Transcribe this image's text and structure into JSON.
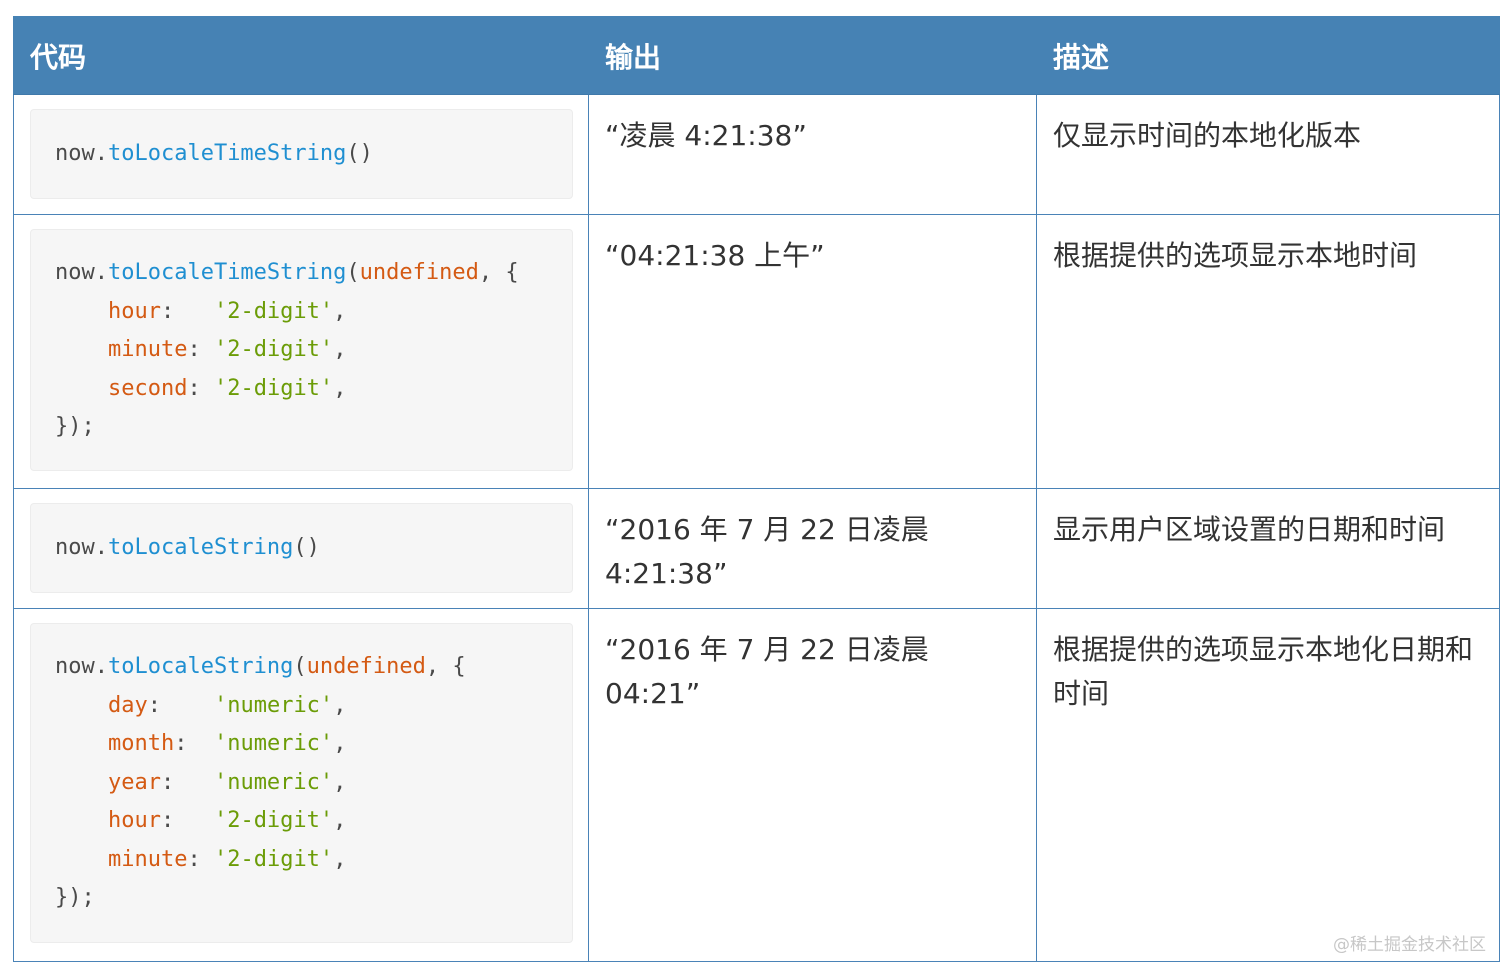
{
  "table": {
    "headers": [
      "代码",
      "输出",
      "描述"
    ],
    "rows": [
      {
        "code": [
          [
            [
              "pun",
              "now."
            ],
            [
              "fn",
              "toLocaleTimeString"
            ],
            [
              "pun",
              "()"
            ]
          ]
        ],
        "output": "“凌晨 4:21:38”",
        "description": "仅显示时间的本地化版本"
      },
      {
        "code": [
          [
            [
              "pun",
              "now."
            ],
            [
              "fn",
              "toLocaleTimeString"
            ],
            [
              "pun",
              "("
            ],
            [
              "kw",
              "undefined"
            ],
            [
              "pun",
              ", {"
            ]
          ],
          [
            [
              "pun",
              "    "
            ],
            [
              "key",
              "hour"
            ],
            [
              "pun",
              ":   "
            ],
            [
              "str",
              "'2-digit'"
            ],
            [
              "pun",
              ","
            ]
          ],
          [
            [
              "pun",
              "    "
            ],
            [
              "key",
              "minute"
            ],
            [
              "pun",
              ": "
            ],
            [
              "str",
              "'2-digit'"
            ],
            [
              "pun",
              ","
            ]
          ],
          [
            [
              "pun",
              "    "
            ],
            [
              "key",
              "second"
            ],
            [
              "pun",
              ": "
            ],
            [
              "str",
              "'2-digit'"
            ],
            [
              "pun",
              ","
            ]
          ],
          [
            [
              "pun",
              "});"
            ]
          ]
        ],
        "output": "“04:21:38 上午”",
        "description": "根据提供的选项显示本地时间"
      },
      {
        "code": [
          [
            [
              "pun",
              "now."
            ],
            [
              "fn",
              "toLocaleString"
            ],
            [
              "pun",
              "()"
            ]
          ]
        ],
        "output": "“2016 年 7 月 22 日凌晨 4:21:38”",
        "description": "显示用户区域设置的日期和时间"
      },
      {
        "code": [
          [
            [
              "pun",
              "now."
            ],
            [
              "fn",
              "toLocaleString"
            ],
            [
              "pun",
              "("
            ],
            [
              "kw",
              "undefined"
            ],
            [
              "pun",
              ", {"
            ]
          ],
          [
            [
              "pun",
              "    "
            ],
            [
              "key",
              "day"
            ],
            [
              "pun",
              ":    "
            ],
            [
              "str",
              "'numeric'"
            ],
            [
              "pun",
              ","
            ]
          ],
          [
            [
              "pun",
              "    "
            ],
            [
              "key",
              "month"
            ],
            [
              "pun",
              ":  "
            ],
            [
              "str",
              "'numeric'"
            ],
            [
              "pun",
              ","
            ]
          ],
          [
            [
              "pun",
              "    "
            ],
            [
              "key",
              "year"
            ],
            [
              "pun",
              ":   "
            ],
            [
              "str",
              "'numeric'"
            ],
            [
              "pun",
              ","
            ]
          ],
          [
            [
              "pun",
              "    "
            ],
            [
              "key",
              "hour"
            ],
            [
              "pun",
              ":   "
            ],
            [
              "str",
              "'2-digit'"
            ],
            [
              "pun",
              ","
            ]
          ],
          [
            [
              "pun",
              "    "
            ],
            [
              "key",
              "minute"
            ],
            [
              "pun",
              ": "
            ],
            [
              "str",
              "'2-digit'"
            ],
            [
              "pun",
              ","
            ]
          ],
          [
            [
              "pun",
              "});"
            ]
          ]
        ],
        "output": "“2016 年 7 月 22 日凌晨 04:21”",
        "description": "根据提供的选项显示本地化日期和时间"
      }
    ]
  },
  "watermark": "@稀土掘金技术社区",
  "colors": {
    "header_bg": "#4682b4",
    "function": "#1f8fd1",
    "keyword": "#d45a13",
    "string": "#6b9c07"
  }
}
